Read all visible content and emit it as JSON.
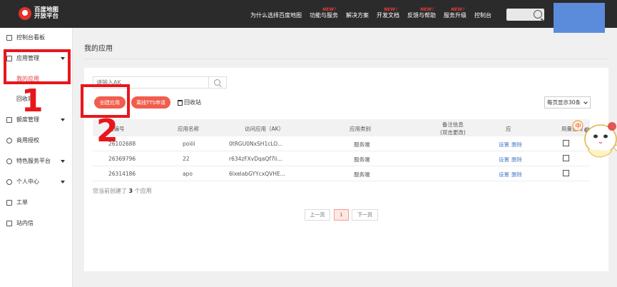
{
  "header": {
    "logo_line1": "百度地图",
    "logo_line2": "开放平台",
    "nav": [
      {
        "label": "为什么选择百度地图",
        "badge": ""
      },
      {
        "label": "功能与服务",
        "badge": "NEW！"
      },
      {
        "label": "解决方案",
        "badge": ""
      },
      {
        "label": "开发文档",
        "badge": "NEW！"
      },
      {
        "label": "反馈与帮助",
        "badge": "NEW！"
      },
      {
        "label": "服务升级",
        "badge": "NEW！"
      },
      {
        "label": "控制台",
        "badge": ""
      }
    ]
  },
  "sidebar": {
    "dashboard": "控制台看板",
    "app_manage": "应用管理",
    "my_apps": "我的应用",
    "recycle": "回收站",
    "quota_manage": "额度管理",
    "commercial_auth": "商用授权",
    "special_services": "特色服务平台",
    "personal_center": "个人中心",
    "work_order": "工单",
    "messages": "站内信"
  },
  "main": {
    "title": "我的应用",
    "ak_placeholder": "请输入AK",
    "create_btn": "创建应用",
    "tts_btn": "离线TTS申请",
    "recycle_link": "回收站",
    "page_size": "每页显示30条"
  },
  "table": {
    "headers": {
      "id": "用编号",
      "name": "应用名称",
      "ak": "访问应用（AK）",
      "category": "应用类别",
      "remark_line1": "备注信息",
      "remark_line2": "(双击更改)",
      "ops": "应",
      "usage": "用量查询"
    },
    "rows": [
      {
        "id": "26102688",
        "name": "poiiii",
        "ak": "0tRGU0NxSH1cLO...",
        "category": "服务端",
        "set": "设置",
        "del": "删除"
      },
      {
        "id": "26369796",
        "name": "22",
        "ak": "r634zFXvDqaQf7li...",
        "category": "服务端",
        "set": "设置",
        "del": "删除"
      },
      {
        "id": "26314186",
        "name": "apo",
        "ak": "6lxelabGYYcxQVHE...",
        "category": "服务端",
        "set": "设置",
        "del": "删除"
      }
    ],
    "summary_prefix": "您当前创建了",
    "summary_count": "3",
    "summary_suffix": "个应用"
  },
  "pager": {
    "prev": "上一页",
    "current": "1",
    "next": "下一页"
  },
  "mascot_badge": "中",
  "annotations": {
    "one": "1",
    "two": "2"
  },
  "colors": {
    "accent": "#f15d4d",
    "annotation": "#e8161b",
    "topbar": "#2b2b2b",
    "link": "#4a7fc9"
  }
}
